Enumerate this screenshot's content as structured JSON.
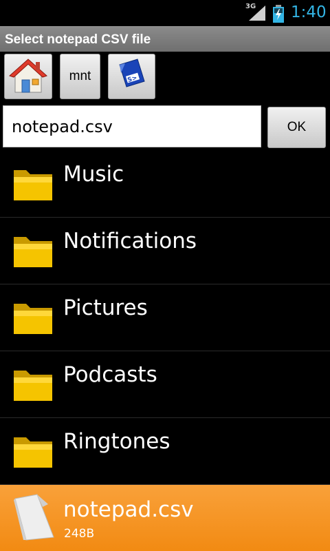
{
  "status": {
    "network": "3G",
    "time": "1:40"
  },
  "title": "Select notepad CSV file",
  "toolbar": {
    "home_icon": "home-icon",
    "mnt_label": "mnt",
    "sd_icon": "sd-card-icon"
  },
  "filename": {
    "value": "notepad.csv"
  },
  "ok_label": "OK",
  "files": [
    {
      "name": "Music",
      "type": "folder"
    },
    {
      "name": "Notifications",
      "type": "folder"
    },
    {
      "name": "Pictures",
      "type": "folder"
    },
    {
      "name": "Podcasts",
      "type": "folder"
    },
    {
      "name": "Ringtones",
      "type": "folder"
    },
    {
      "name": "notepad.csv",
      "type": "file",
      "size": "248B",
      "selected": true
    }
  ],
  "colors": {
    "clock": "#33b5e5",
    "selection": "#f28a12",
    "folder": "#f5c400"
  }
}
